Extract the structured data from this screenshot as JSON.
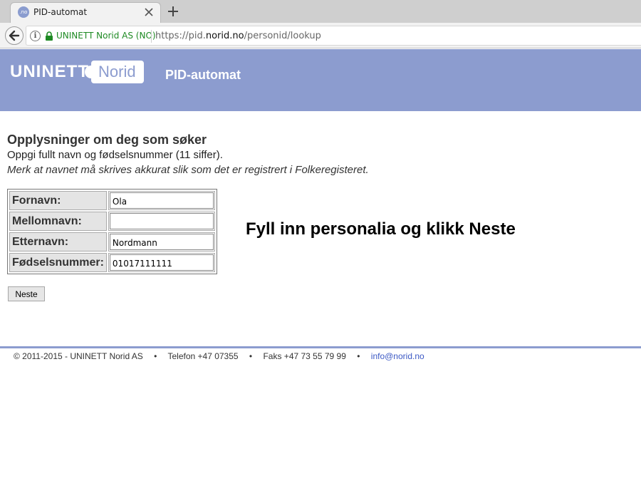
{
  "browser": {
    "tab_title": "PID-automat",
    "favicon_text": ".no",
    "cert_label": "UNINETT Norid AS (NO)",
    "url_prefix": "https://pid.",
    "url_domain": "norid.no",
    "url_path": "/personid/lookup"
  },
  "header": {
    "logo_left": "UNINETT",
    "logo_right": "Norid",
    "title": "PID-automat",
    "color": "#8c9ccf"
  },
  "main": {
    "heading": "Opplysninger om deg som søker",
    "subtext": "Oppgi fullt navn og fødselsnummer (11 siffer).",
    "note": "Merk at navnet må skrives akkurat slik som det er registrert i Folkeregisteret.",
    "fields": [
      {
        "label": "Fornavn:",
        "value": "Ola"
      },
      {
        "label": "Mellomnavn:",
        "value": ""
      },
      {
        "label": "Etternavn:",
        "value": "Nordmann"
      },
      {
        "label": "Fødselsnummer:",
        "value": "01017111111"
      }
    ],
    "callout": "Fyll inn personalia og klikk Neste",
    "next_label": "Neste"
  },
  "footer": {
    "copyright": "© 2011-2015 - UNINETT Norid AS",
    "phone": "Telefon +47 07355",
    "fax": "Faks +47 73 55 79 99",
    "email": "info@norid.no",
    "separator": "•",
    "link_color": "#3b58c4"
  }
}
